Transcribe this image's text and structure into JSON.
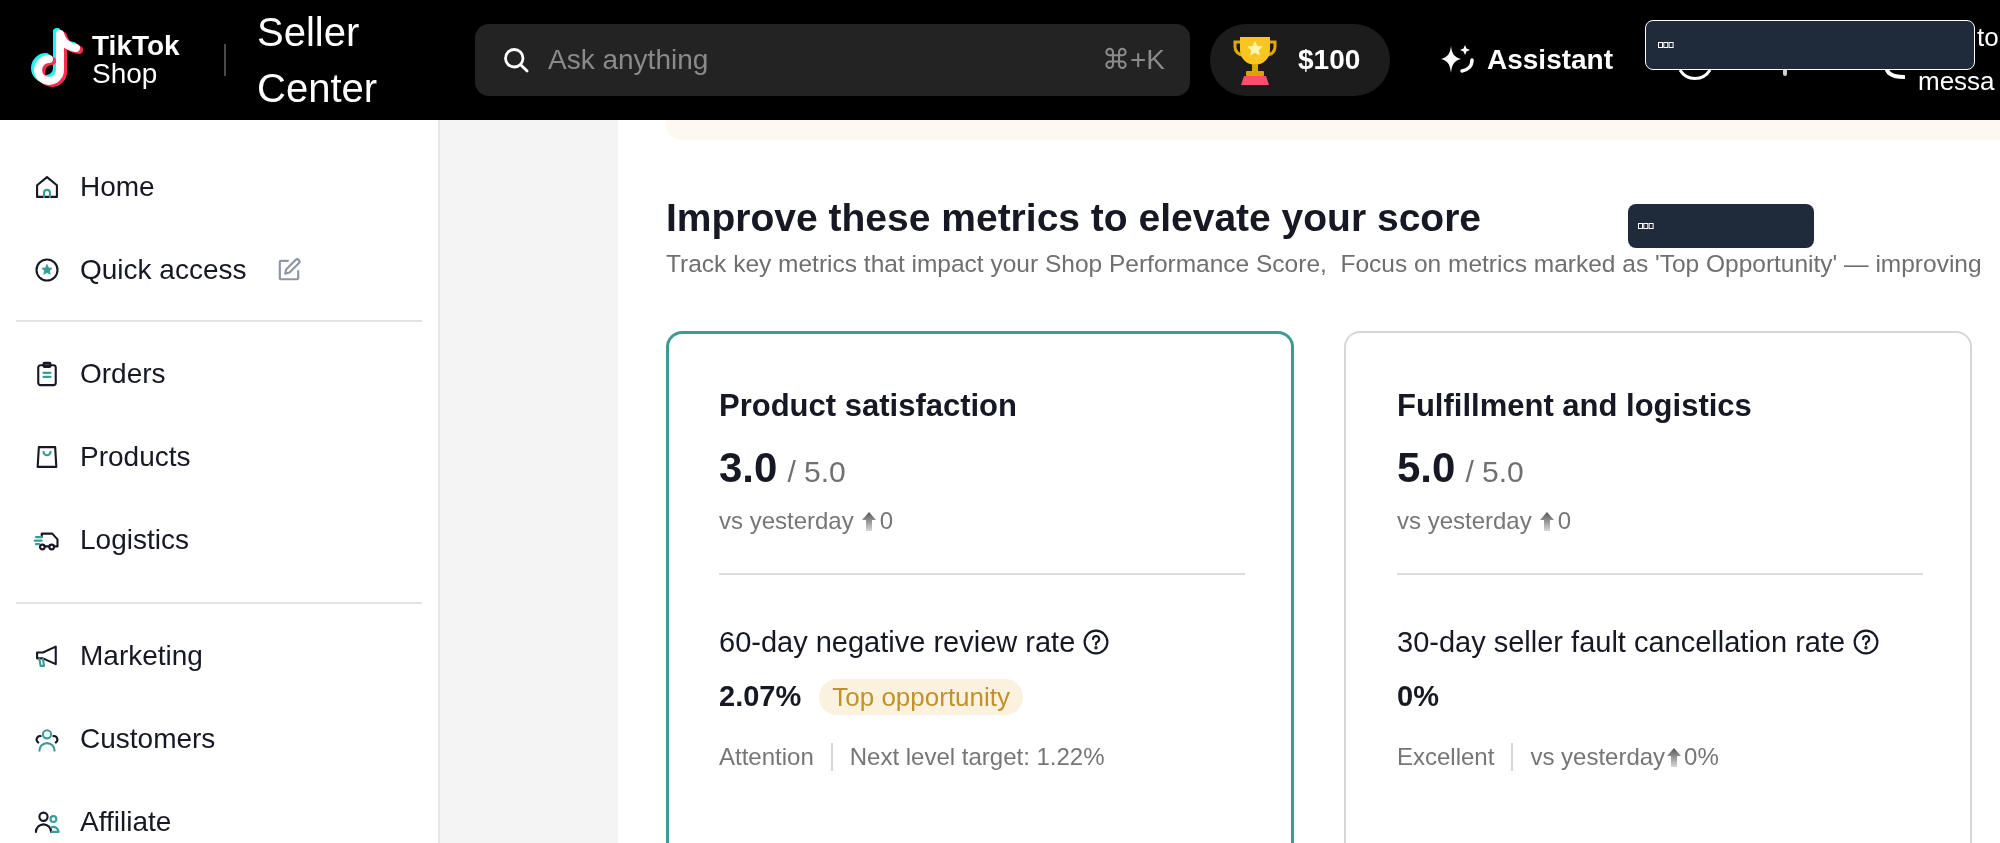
{
  "top_bar": {
    "logo": {
      "brand": "TikTok",
      "product": "Shop"
    },
    "app_title": "Seller Center",
    "search": {
      "placeholder": "Ask anything",
      "shortcut": "⌘+K"
    },
    "reward": {
      "amount": "$100"
    },
    "assistant": {
      "label": "Assistant"
    },
    "partial_texts": [
      "to",
      "messa"
    ]
  },
  "sidebar": {
    "groups": [
      {
        "items": [
          {
            "label": "Home",
            "selected": false,
            "editable": false
          },
          {
            "label": "Quick access",
            "selected": false,
            "editable": true
          }
        ]
      },
      {
        "items": [
          {
            "label": "Orders",
            "selected": false,
            "editable": false
          },
          {
            "label": "Products",
            "selected": false,
            "editable": false
          },
          {
            "label": "Logistics",
            "selected": false,
            "editable": false
          }
        ]
      },
      {
        "items": [
          {
            "label": "Marketing",
            "selected": false,
            "editable": false
          },
          {
            "label": "Customers",
            "selected": false,
            "editable": false
          },
          {
            "label": "Affiliate",
            "selected": false,
            "editable": false
          }
        ]
      }
    ]
  },
  "main": {
    "heading": "Improve these metrics to elevate your score",
    "subtitle": "Track key metrics that impact your Shop Performance Score,  Focus on metrics marked as 'Top Opportunity' — improving",
    "cards": [
      {
        "title": "Product satisfaction",
        "selected": true,
        "score": "3.0",
        "max": "/ 5.0",
        "change": {
          "label": "vs yesterday",
          "rising": true,
          "value": "0"
        },
        "metric": {
          "name": "60-day negative review rate",
          "value": "2.07%",
          "badge": "Top opportunity",
          "status": "Attention",
          "detail": {
            "kind": "target",
            "text": "Next level target: 1.22%"
          }
        }
      },
      {
        "title": "Fulfillment and logistics",
        "selected": false,
        "score": "5.0",
        "max": "/ 5.0",
        "change": {
          "label": "vs yesterday",
          "rising": true,
          "value": "0"
        },
        "metric": {
          "name": "30-day seller fault cancellation rate",
          "value": "0%",
          "status": "Excellent",
          "detail": {
            "kind": "change",
            "label": "vs yesterday",
            "rising": true,
            "value": "0%"
          }
        }
      }
    ]
  }
}
